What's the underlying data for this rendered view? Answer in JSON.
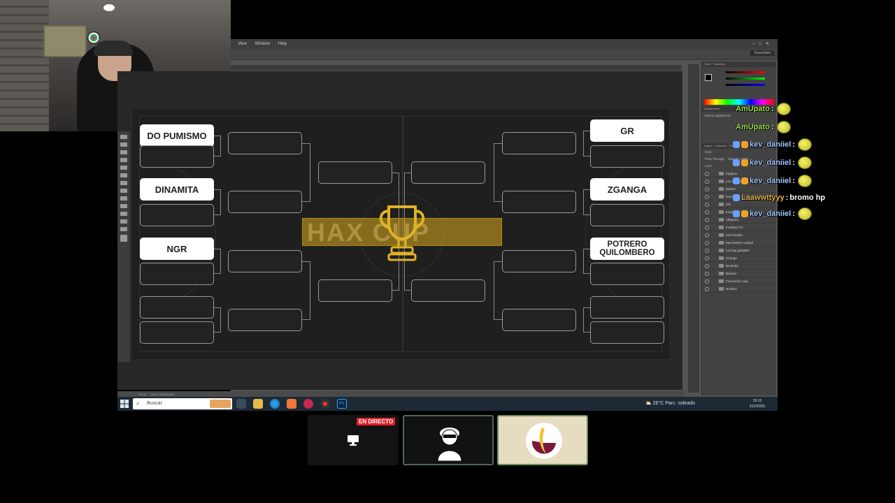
{
  "photoshop": {
    "menu": [
      "View",
      "Window",
      "Help"
    ],
    "workspace": "Essentials",
    "status_doc": "Doc: 3,74M/66,9M",
    "zoom": "95,3%",
    "panels": {
      "color_tabs": [
        "Color",
        "Swatches"
      ],
      "adjustments_tab": "Adjustments",
      "adjustments_hint": "Add an adjustment",
      "layers_tabs": [
        "Layers",
        "Channels",
        "Paths"
      ],
      "kind_label": "Kind",
      "blend_mode": "Pass Through",
      "opacity_label": "Opacity:",
      "opacity_value": "100%",
      "lock_label": "Lock:",
      "layers": [
        "Equipos",
        "Los andinos",
        "Walsat",
        "Gombrilas Do Pumisi...",
        "GR",
        "Kuserro",
        "Albaperq",
        "Invalibes FC",
        "Anti Gardas",
        "Manchester Unidad",
        "Los kap globales",
        "zGanga",
        "Dinamita",
        "Bracket",
        "Formación copy",
        "Nombre"
      ]
    }
  },
  "bracket": {
    "teams_left": [
      "DO PUMISMO",
      "DINAMITA",
      "NGR"
    ],
    "teams_right": [
      "GR",
      "ZGANGA",
      "POTRERO QUILOMBERO"
    ],
    "banner_text": "HAX CUP"
  },
  "chat": [
    {
      "user": "AmUpato",
      "sep": ":",
      "msg": "",
      "color": "green",
      "badges": 0
    },
    {
      "user": "AmUpato",
      "sep": ":",
      "msg": "",
      "color": "green",
      "badges": 0
    },
    {
      "user": "kev_daniiel",
      "sep": ":",
      "msg": "",
      "color": "blue",
      "badges": 2
    },
    {
      "user": "kev_daniiel",
      "sep": ":",
      "msg": "",
      "color": "blue",
      "badges": 2
    },
    {
      "user": "kev_daniiel",
      "sep": ":",
      "msg": "",
      "color": "blue",
      "badges": 2
    },
    {
      "user": "Laawwttyyy",
      "sep": ":",
      "msg": "bromo hp",
      "color": "orange",
      "badges": 1
    },
    {
      "user": "kev_daniiel",
      "sep": ":",
      "msg": "",
      "color": "blue",
      "badges": 2
    }
  ],
  "taskbar": {
    "search_placeholder": "Buscar",
    "weather": "26°C  Parc. soleado",
    "time": "19:15",
    "date": "21/2/2026"
  },
  "stream": {
    "live_label": "EN DIRECTO"
  },
  "colors": {
    "trophy": "#e0b324",
    "banner": "#dbaa1f"
  }
}
